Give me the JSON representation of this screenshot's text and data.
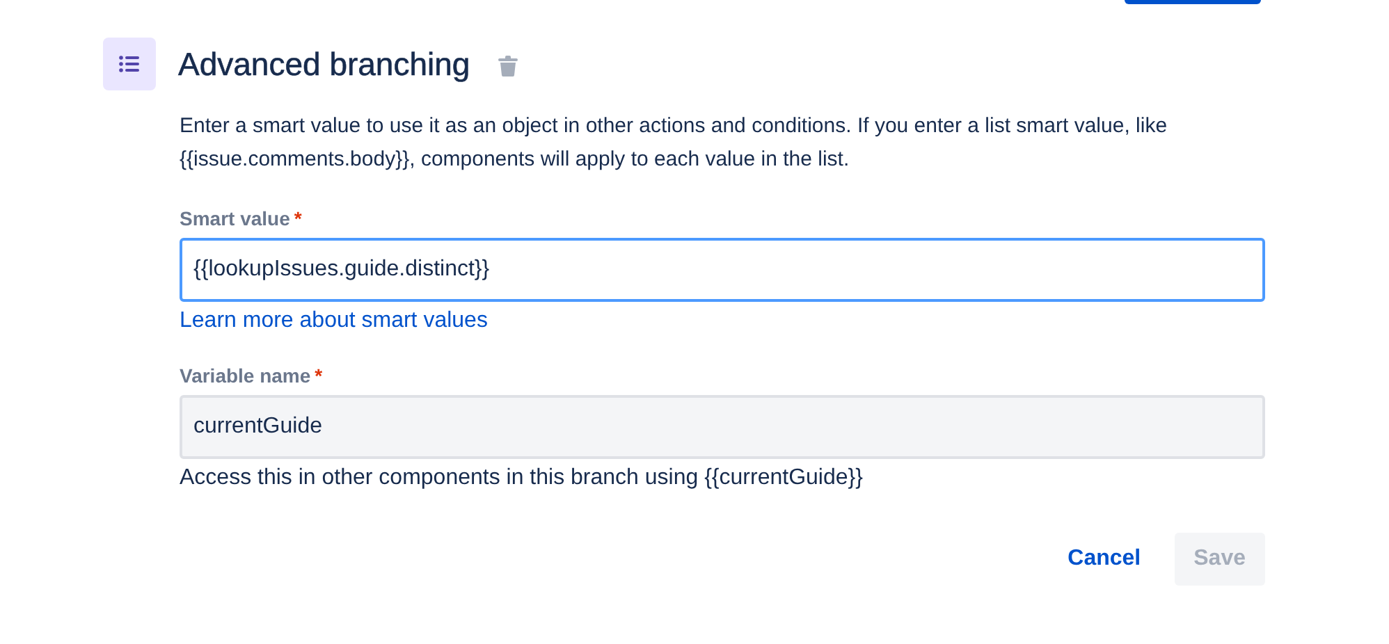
{
  "header": {
    "title": "Advanced branching"
  },
  "description": "Enter a smart value to use it as an object in other actions and conditions. If you enter a list smart value, like {{issue.comments.body}}, components will apply to each value in the list.",
  "fields": [
    {
      "label": "Smart value",
      "required": true,
      "value": "{{lookupIssues.guide.distinct}}",
      "focused": true,
      "link": "Learn more about smart values"
    },
    {
      "label": "Variable name",
      "required": true,
      "value": "currentGuide",
      "focused": false,
      "help": "Access this in other components in this branch using {{currentGuide}}"
    }
  ],
  "required_mark": "*",
  "buttons": [
    {
      "label": "Cancel",
      "kind": "subtle",
      "disabled": false
    },
    {
      "label": "Save",
      "kind": "primary",
      "disabled": true
    }
  ]
}
